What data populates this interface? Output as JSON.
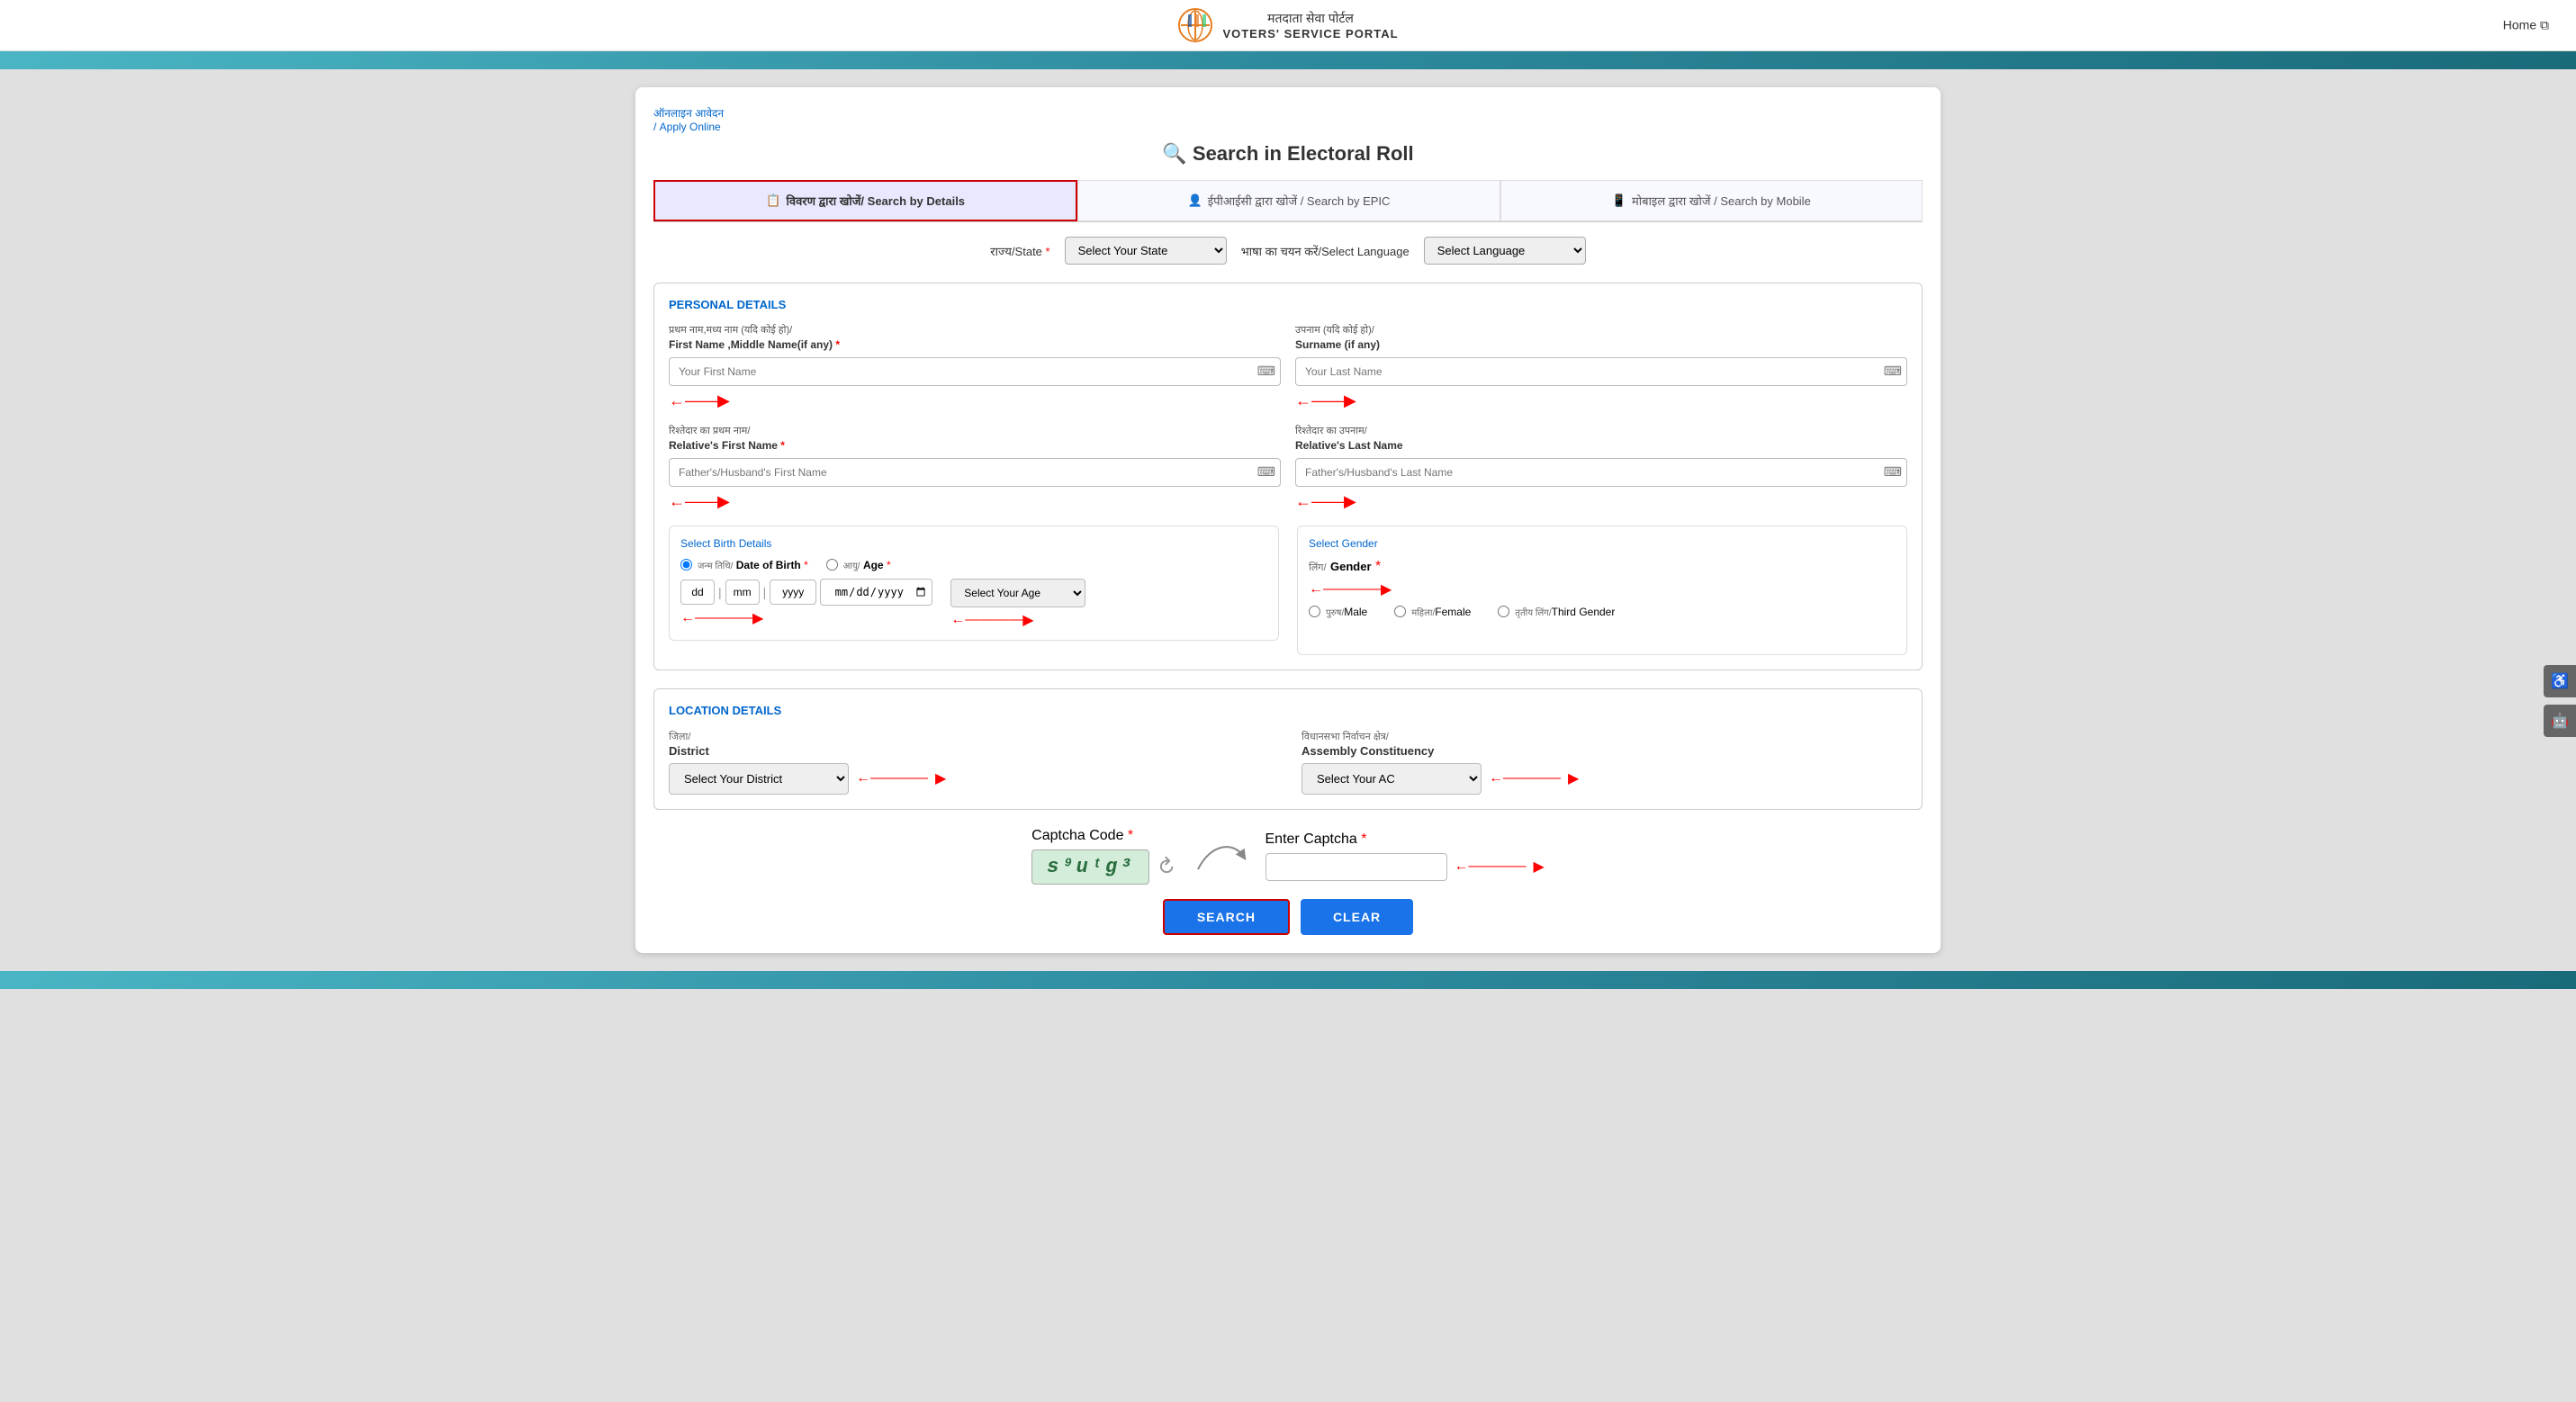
{
  "header": {
    "portal_hindi": "मतदाता सेवा पोर्टल",
    "portal_english": "VOTERS' SERVICE PORTAL",
    "home_label": "Home ⧉"
  },
  "breadcrumb": {
    "line1": "ऑनलाइन आवेदन",
    "line2": "/ Apply Online"
  },
  "page_title": "Search in Electoral Roll",
  "tabs": [
    {
      "id": "details",
      "icon": "📋",
      "label": "विवरण द्वारा खोजें/ Search by Details",
      "active": true
    },
    {
      "id": "epic",
      "icon": "👤",
      "label": "ईपीआईसी द्वारा खोजें / Search by EPIC",
      "active": false
    },
    {
      "id": "mobile",
      "icon": "📱",
      "label": "मोबाइल द्वारा खोजें / Search by Mobile",
      "active": false
    }
  ],
  "filters": {
    "state_label": "राज्य/State",
    "state_placeholder": "Select Your State",
    "language_label": "भाषा का चयन करें/Select Language",
    "language_placeholder": "Select Language"
  },
  "personal_section": {
    "title": "PERSONAL DETAILS",
    "first_name_hindi": "प्रथम नाम,मध्य नाम (यदि कोई हो)/",
    "first_name_label": "First Name ,Middle Name(if any)",
    "first_name_placeholder": "Your First Name",
    "surname_hindi": "उपनाम (यदि कोई हो)/",
    "surname_label": "Surname (if any)",
    "surname_placeholder": "Your Last Name",
    "relative_first_hindi": "रिश्तेदार का प्रथम नाम/",
    "relative_first_label": "Relative's First Name",
    "relative_first_placeholder": "Father's/Husband's First Name",
    "relative_last_hindi": "रिश्तेदार का उपनाम/",
    "relative_last_label": "Relative's Last Name",
    "relative_last_placeholder": "Father's/Husband's Last Name"
  },
  "birth_section": {
    "title": "Select Birth Details",
    "dob_hindi": "जन्म तिथि/",
    "dob_label": "Date of Birth",
    "dob_dd": "dd",
    "dob_mm": "mm",
    "dob_yyyy": "yyyy",
    "age_hindi": "आयु/",
    "age_label": "Age",
    "age_placeholder": "Select Your Age"
  },
  "gender_section": {
    "title": "Select Gender",
    "gender_hindi": "लिंग/",
    "gender_label": "Gender",
    "options": [
      {
        "value": "male",
        "label_hindi": "पुरुष/",
        "label": "Male"
      },
      {
        "value": "female",
        "label_hindi": "महिला/",
        "label": "Female"
      },
      {
        "value": "other",
        "label_hindi": "तृतीय लिंग/",
        "label": "Third Gender"
      }
    ]
  },
  "location_section": {
    "title": "LOCATION DETAILS",
    "district_hindi": "जिला/",
    "district_label": "District",
    "district_placeholder": "Select Your District",
    "ac_hindi": "विधानसभा निर्वाचन क्षेत्र/",
    "ac_label": "Assembly Constituency",
    "ac_placeholder": "Select Your AC"
  },
  "captcha_section": {
    "code_label": "Captcha Code",
    "code_value": "s⁹uᵗg³",
    "enter_label": "Enter Captcha",
    "enter_placeholder": ""
  },
  "buttons": {
    "search": "SEARCH",
    "clear": "CLEAR"
  },
  "floating": {
    "btn1": "♿",
    "btn2": "🤖"
  }
}
